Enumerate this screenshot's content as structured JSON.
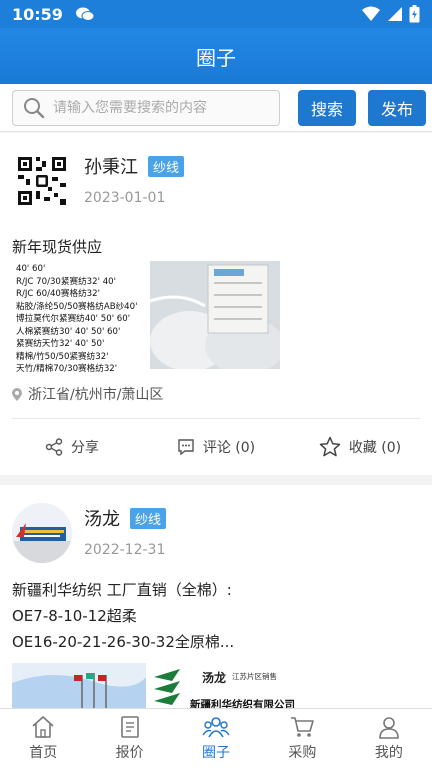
{
  "status": {
    "time": "10:59"
  },
  "header": {
    "title": "圈子"
  },
  "search": {
    "placeholder": "请输入您需要搜索的内容",
    "search_label": "搜索",
    "publish_label": "发布"
  },
  "posts": [
    {
      "author": "孙秉江",
      "badge": "纱线",
      "date": "2023-01-01",
      "title": "新年现货供应",
      "image_text": [
        "40' 60'",
        "R/JC 70/30紧赛纺32' 40'",
        "R/JC 60/40赛格纺32'",
        "粘胶/涤纶50/50赛格纺AB纱40'",
        "博拉莫代尔紧赛纺40' 50' 60'",
        "人棉紧赛纺30' 40' 50' 60'",
        "紧赛纺天竹32' 40' 50'",
        "精棉/竹50/50紧赛纺32'",
        "天竹/精棉70/30赛格纺32'"
      ],
      "location": "浙江省/杭州市/萧山区",
      "share": "分享",
      "comment": "评论 (0)",
      "favorite": "收藏 (0)"
    },
    {
      "author": "汤龙",
      "badge": "纱线",
      "date": "2022-12-31",
      "lines": [
        "新疆利华纺织 工厂直销（全棉）:",
        "OE7-8-10-12超柔",
        "OE16-20-21-26-30-32全原棉..."
      ],
      "sign_text": {
        "name": "汤龙",
        "area": "江苏片区销售",
        "company": "新疆利华纺织有限公司"
      }
    }
  ],
  "tabs": [
    {
      "label": "首页",
      "icon": "home-icon"
    },
    {
      "label": "报价",
      "icon": "document-icon"
    },
    {
      "label": "圈子",
      "icon": "community-icon"
    },
    {
      "label": "采购",
      "icon": "cart-icon"
    },
    {
      "label": "我的",
      "icon": "user-icon"
    }
  ]
}
